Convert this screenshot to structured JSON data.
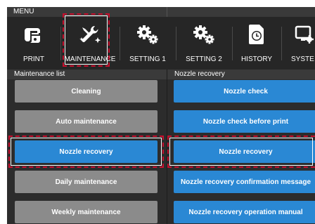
{
  "menu": {
    "title": "MENU"
  },
  "nav": {
    "items": [
      {
        "label": "PRINT",
        "icon": "print-icon"
      },
      {
        "label": "MAINTENANCE",
        "icon": "maintenance-icon"
      },
      {
        "label": "SETTING 1",
        "icon": "gears-icon"
      },
      {
        "label": "SETTING 2",
        "icon": "gears-icon"
      },
      {
        "label": "HISTORY",
        "icon": "history-icon"
      },
      {
        "label": "SYSTE",
        "icon": "system-icon"
      }
    ],
    "selected": "MAINTENANCE"
  },
  "left_panel": {
    "title": "Maintenance list",
    "items": [
      {
        "label": "Cleaning",
        "state": "normal"
      },
      {
        "label": "Auto maintenance",
        "state": "normal"
      },
      {
        "label": "Nozzle recovery",
        "state": "selected"
      },
      {
        "label": "Daily maintenance",
        "state": "normal"
      },
      {
        "label": "Weekly maintenance",
        "state": "normal"
      }
    ]
  },
  "right_panel": {
    "title": "Nozzle recovery",
    "items": [
      {
        "label": "Nozzle check"
      },
      {
        "label": "Nozzle check before print"
      },
      {
        "label": "Nozzle recovery"
      },
      {
        "label": "Nozzle recovery confirmation message"
      },
      {
        "label": "Nozzle recovery operation manual"
      }
    ]
  },
  "colors": {
    "background": "#2c2c2c",
    "button_gray": "#8b8b8b",
    "button_blue": "#2a88d4",
    "highlight": "#c8102e"
  }
}
